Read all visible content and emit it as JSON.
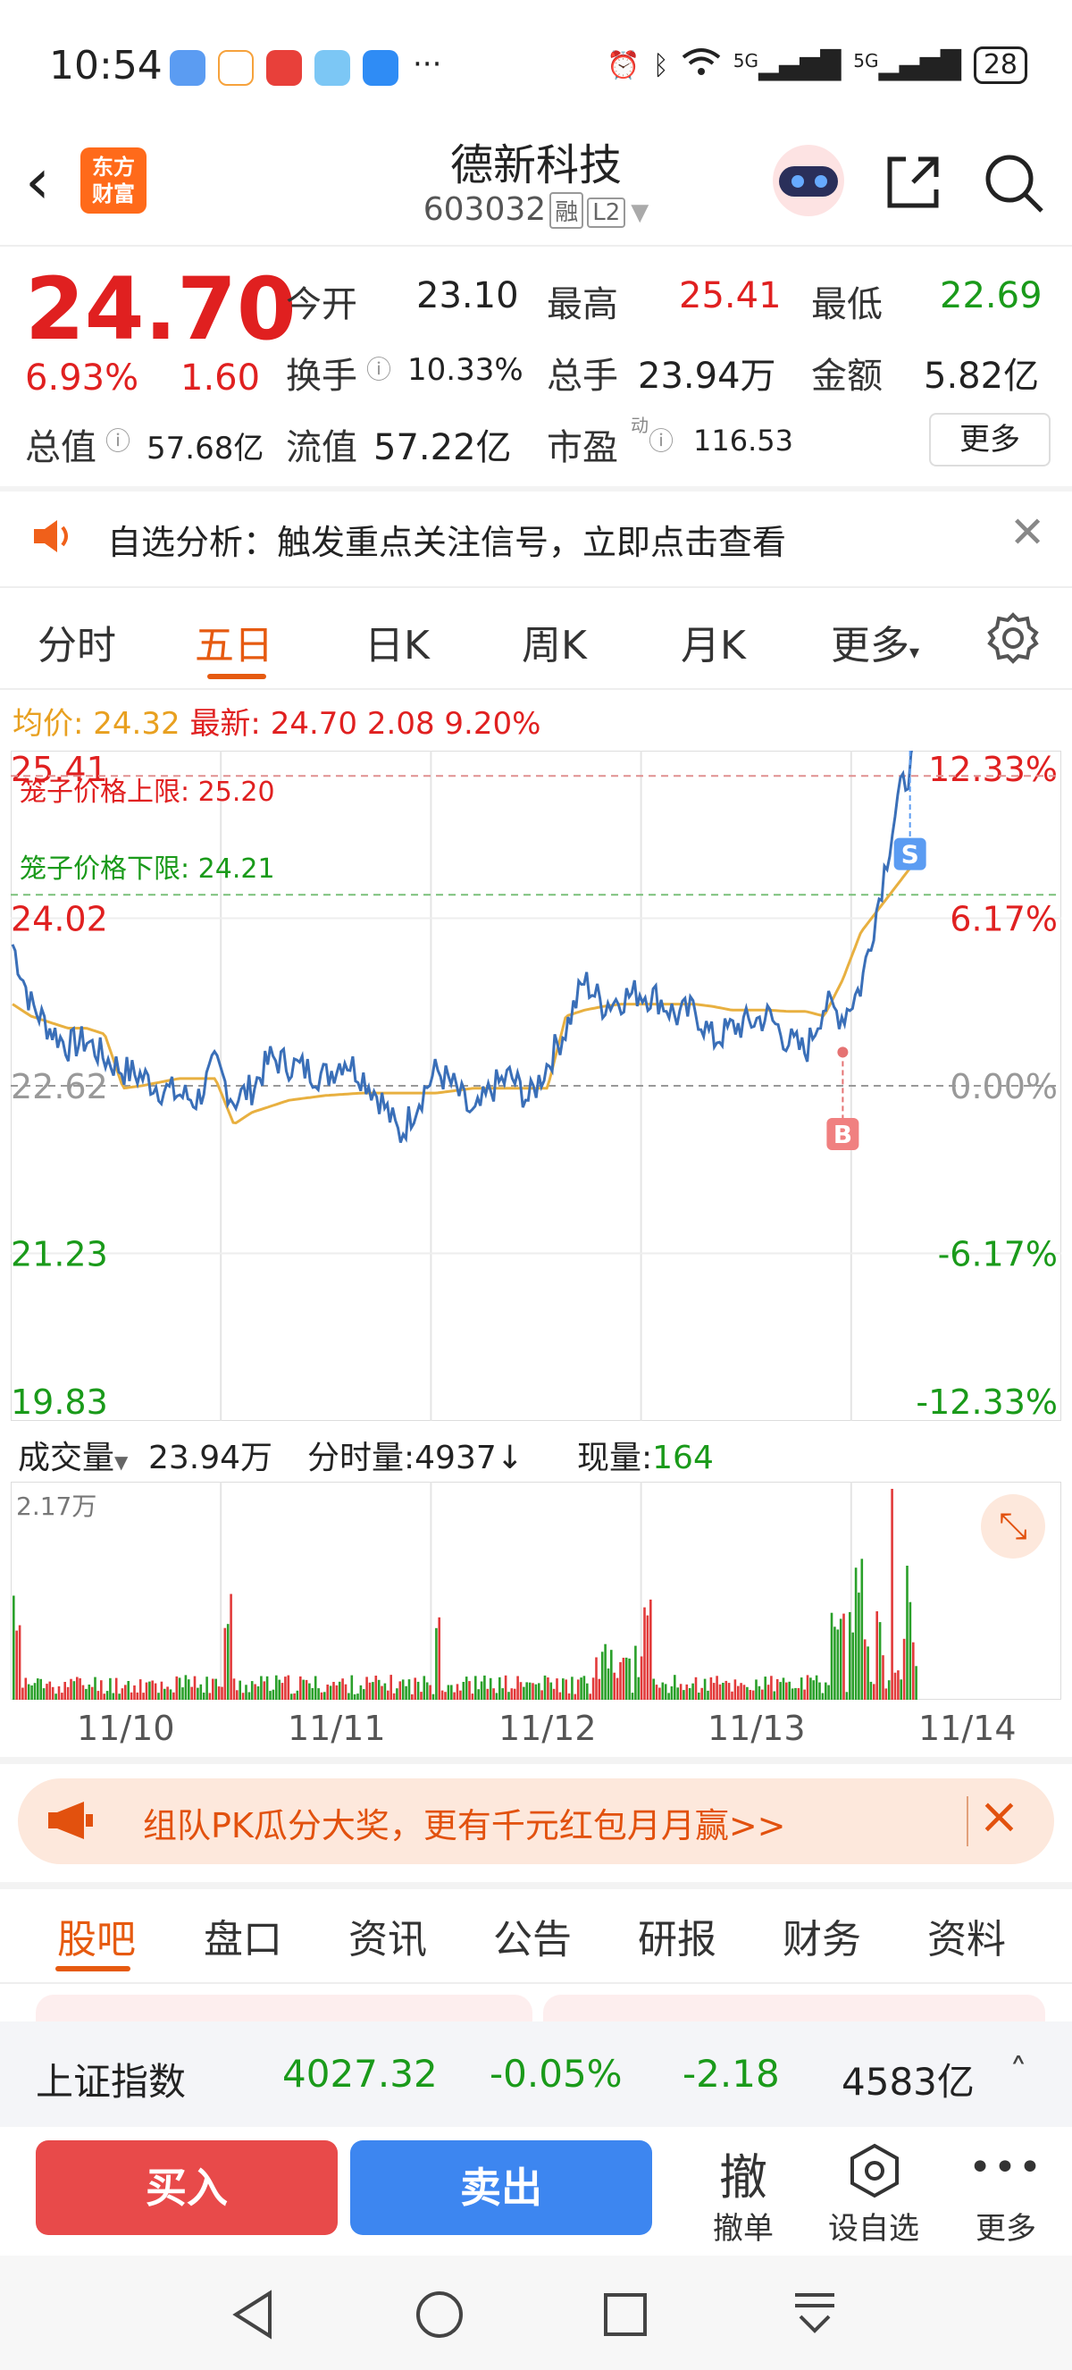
{
  "status_bar": {
    "time": "10:54",
    "network_1": "5G",
    "network_2": "5G",
    "battery": "28",
    "more": "···"
  },
  "header": {
    "logo_line1": "东方",
    "logo_line2": "财富",
    "stock_name": "德新科技",
    "stock_code": "603032",
    "tag_margin": "融",
    "tag_level": "L2"
  },
  "quote": {
    "price": "24.70",
    "change_pct": "6.93%",
    "change_amt": "1.60",
    "total_value_label": "总值",
    "total_value": "57.68亿",
    "open_label": "今开",
    "open": "23.10",
    "high_label": "最高",
    "high": "25.41",
    "low_label": "最低",
    "low": "22.69",
    "turnover_label": "换手",
    "turnover": "10.33%",
    "volume_label": "总手",
    "volume": "23.94万",
    "amount_label": "金额",
    "amount": "5.82亿",
    "float_value_label": "流值",
    "float_value": "57.22亿",
    "pe_label": "市盈",
    "pe_sup": "动",
    "pe": "116.53",
    "more_label": "更多"
  },
  "notice": {
    "text": "自选分析：触发重点关注信号，立即点击查看"
  },
  "tabs": [
    "分时",
    "五日",
    "日K",
    "周K",
    "月K",
    "更多"
  ],
  "active_tab": "五日",
  "avg_line": {
    "avg_label": "均价:",
    "avg_value": "24.32",
    "latest_label": "最新:",
    "latest_value": "24.70",
    "latest_change": "2.08",
    "latest_pct": "9.20%"
  },
  "chart_data": {
    "type": "line",
    "x": [
      "11/10",
      "11/11",
      "11/12",
      "11/13",
      "11/14"
    ],
    "y_left_ticks": [
      "25.41",
      "24.02",
      "22.62",
      "21.23",
      "19.83"
    ],
    "y_right_ticks": [
      "12.33%",
      "6.17%",
      "0.00%",
      "-6.17%",
      "-12.33%"
    ],
    "ylim": [
      19.83,
      25.41
    ],
    "upper_limit_label": "笼子价格上限:",
    "upper_limit": "25.20",
    "lower_limit_label": "笼子价格下限:",
    "lower_limit": "24.21",
    "buy_marker": "B",
    "sell_marker": "S",
    "series": [
      {
        "values": [
          23.8,
          23.3,
          23.1,
          22.95,
          23.0,
          22.85,
          22.75,
          22.7,
          22.6,
          22.55,
          22.5,
          22.8,
          22.5,
          22.6,
          22.85,
          22.8,
          22.75,
          22.7,
          22.85,
          22.7,
          22.5,
          22.2,
          22.5,
          22.75,
          22.6,
          22.35,
          22.6,
          22.7,
          22.5,
          22.8,
          23.1,
          23.5,
          23.3,
          23.35,
          23.4,
          23.35,
          23.2,
          23.25,
          23.0,
          23.1,
          23.15,
          23.2,
          23.0,
          22.9,
          23.3,
          23.2,
          23.45,
          24.2,
          25.0,
          25.41
        ]
      },
      {
        "values": [
          23.3,
          23.2,
          23.15,
          23.1,
          23.1,
          23.05,
          22.6,
          22.62,
          22.65,
          22.68,
          22.68,
          22.68,
          22.3,
          22.4,
          22.45,
          22.5,
          22.52,
          22.54,
          22.55,
          22.56,
          22.56,
          22.56,
          22.56,
          22.56,
          22.58,
          22.6,
          22.6,
          22.6,
          22.6,
          22.6,
          23.2,
          23.25,
          23.28,
          23.3,
          23.3,
          23.3,
          23.3,
          23.3,
          23.28,
          23.25,
          23.25,
          23.25,
          23.24,
          23.24,
          23.2,
          23.5,
          23.9,
          24.1,
          24.3,
          24.5
        ]
      }
    ]
  },
  "volume_header": {
    "label": "成交量",
    "total": "23.94万",
    "period_label": "分时量:",
    "period_value": "4937",
    "period_arrow": "↓",
    "now_label": "现量:",
    "now_value": "164",
    "max_label": "2.17万"
  },
  "dates": [
    "11/10",
    "11/11",
    "11/12",
    "11/13",
    "11/14"
  ],
  "promo": {
    "text": "组队PK瓜分大奖，更有千元红包月月赢>>"
  },
  "bottom_tabs": [
    "股吧",
    "盘口",
    "资讯",
    "公告",
    "研报",
    "财务",
    "资料"
  ],
  "index_bar": {
    "name": "上证指数",
    "value": "4027.32",
    "pct": "-0.05%",
    "change": "-2.18",
    "amount": "4583亿"
  },
  "actions": {
    "buy": "买入",
    "sell": "卖出",
    "cancel_icon": "撤",
    "cancel": "撤单",
    "watch": "设自选",
    "more": "更多"
  },
  "colors": {
    "up": "#e02020",
    "down": "#1a9a1a",
    "accent": "#e65a10",
    "buy": "#e84a4a",
    "sell": "#3d86f0",
    "avg_line": "#e8b040",
    "price_line": "#3a6fb8"
  }
}
